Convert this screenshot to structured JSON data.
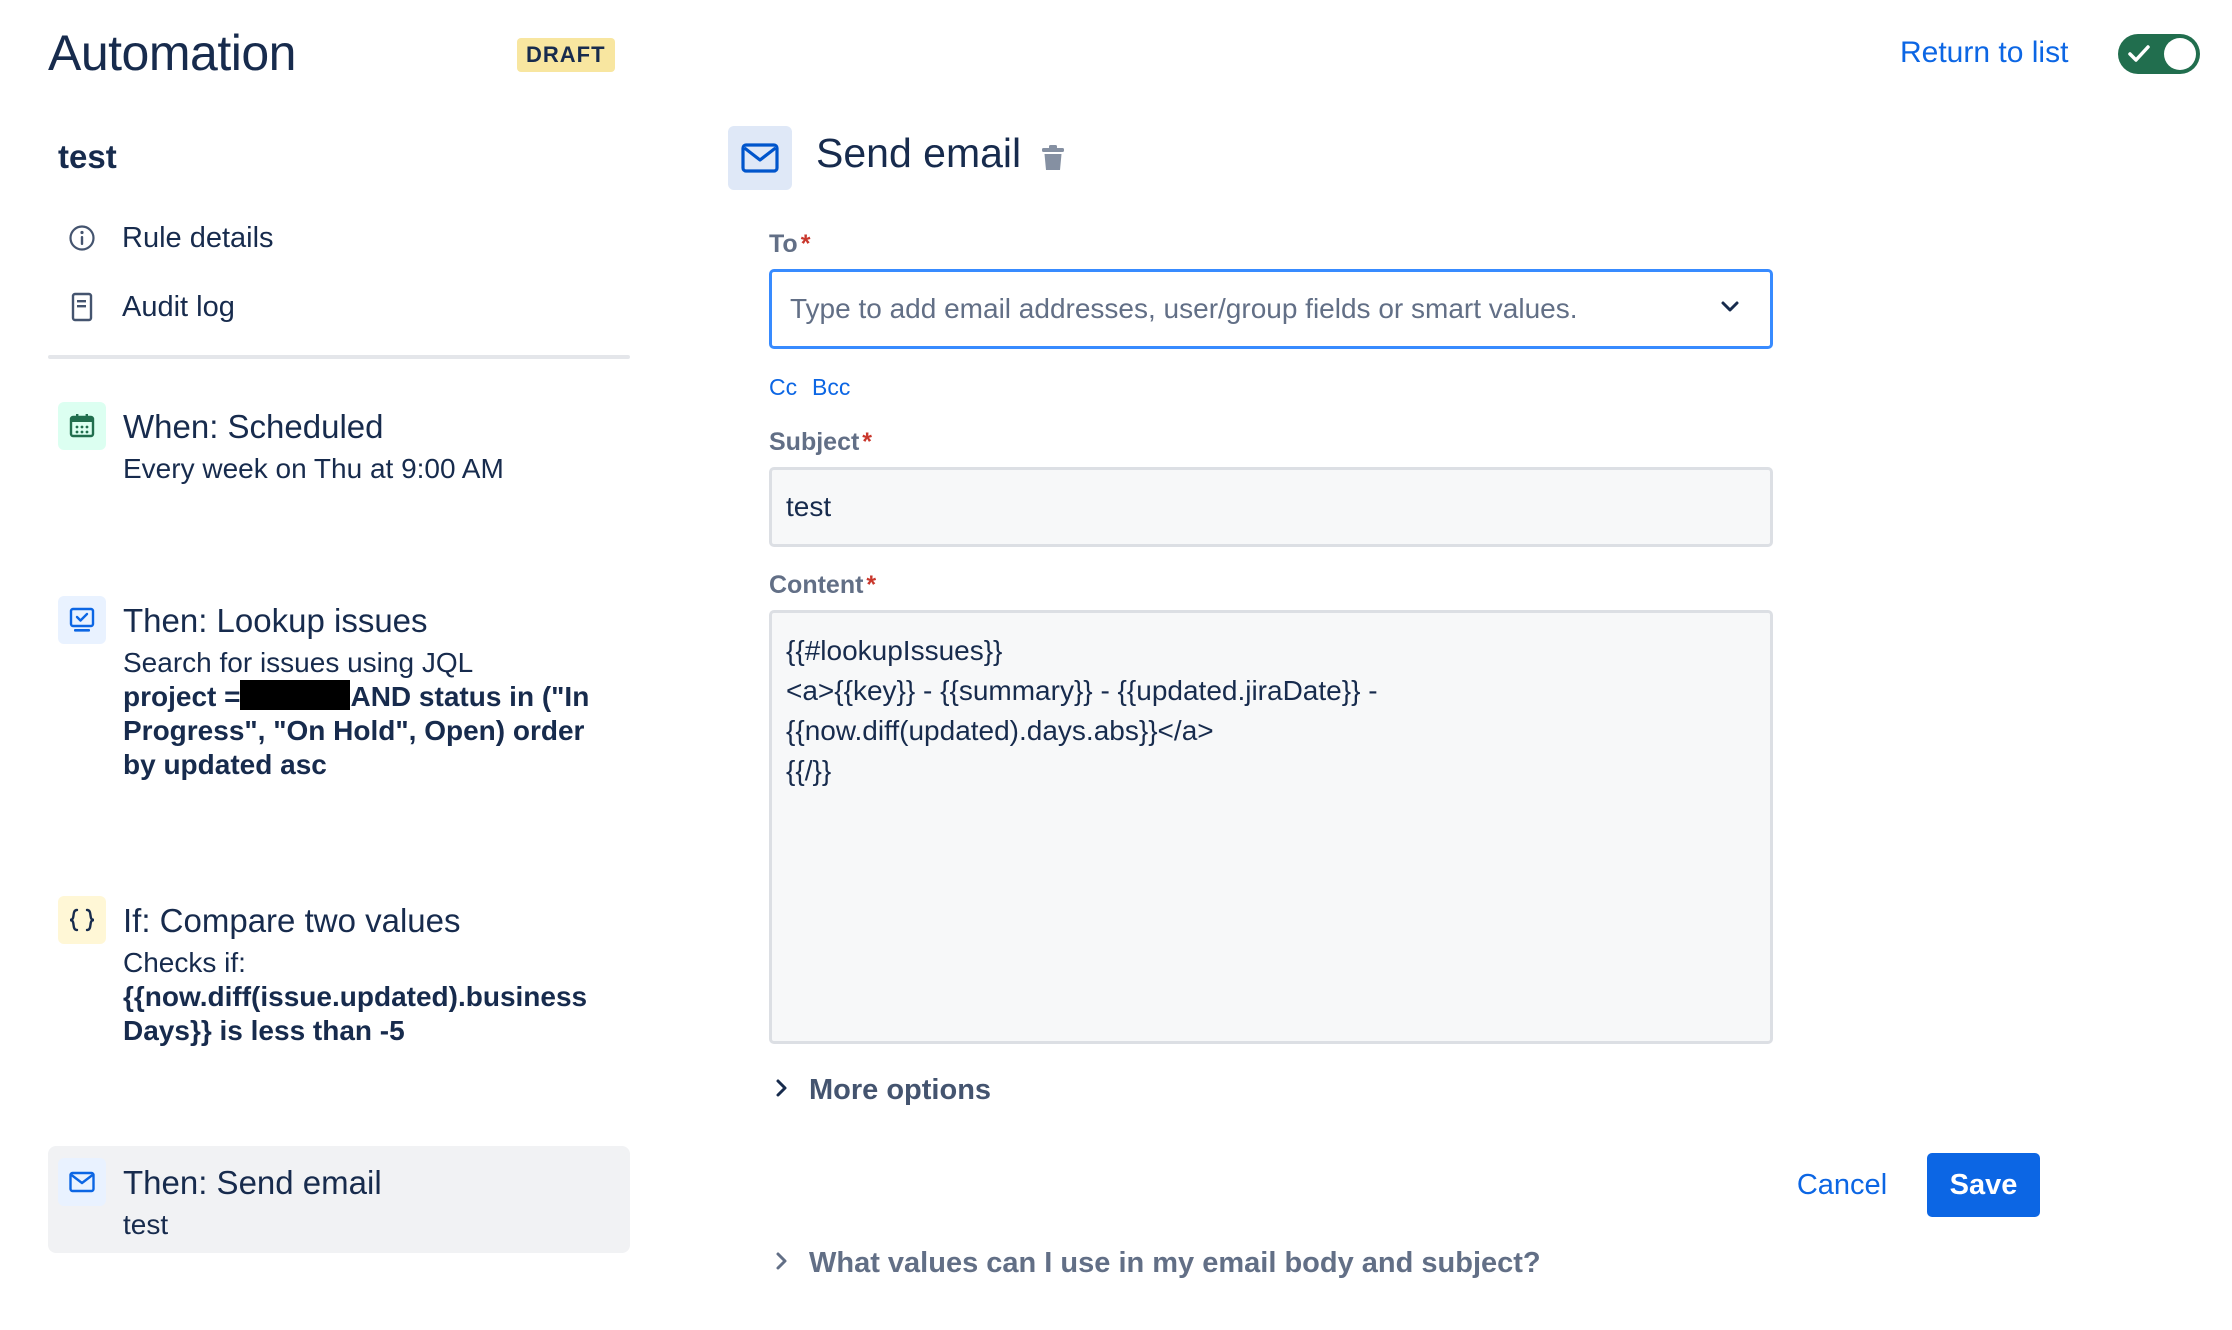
{
  "header": {
    "app_title": "Automation",
    "status_badge": "DRAFT",
    "return_link": "Return to list",
    "enabled_toggle": true
  },
  "sidebar": {
    "rule_name": "test",
    "nav": [
      {
        "label": "Rule details",
        "icon": "info-icon"
      },
      {
        "label": "Audit log",
        "icon": "document-icon"
      }
    ],
    "steps": [
      {
        "icon": "calendar-icon",
        "icon_bg": "#dcfff1",
        "title": "When: Scheduled",
        "desc": "Every week on Thu at 9:00 AM"
      },
      {
        "icon": "lookup-icon",
        "icon_bg": "#e9f2ff",
        "title": "Then: Lookup issues",
        "desc_line1": "Search for issues using JQL",
        "desc_bold_prefix": "project =",
        "desc_bold_suffix": "AND status in (\"In Progress\", \"On Hold\", Open) order by updated asc"
      },
      {
        "icon": "braces-icon",
        "icon_bg": "#fff7d6",
        "title": "If: Compare two values",
        "desc_line1": "Checks if:",
        "desc_bold": "{{now.diff(issue.updated).business Days}} is less than -5"
      },
      {
        "icon": "mail-icon",
        "icon_bg": "#e9f2ff",
        "title": "Then: Send email",
        "desc": "test",
        "active": true
      }
    ]
  },
  "panel": {
    "title": "Send email",
    "to": {
      "label": "To",
      "required_mark": "*",
      "placeholder": "Type to add email addresses, user/group fields or smart values."
    },
    "cc_label": "Cc",
    "bcc_label": "Bcc",
    "subject": {
      "label": "Subject",
      "required_mark": "*",
      "value": "test"
    },
    "content": {
      "label": "Content",
      "required_mark": "*",
      "value": "{{#lookupIssues}}\n<a>{{key}} - {{summary}} - {{updated.jiraDate}} -\n{{now.diff(updated).days.abs}}</a>\n{{/}}"
    },
    "more_options": "More options",
    "cancel_label": "Cancel",
    "save_label": "Save",
    "help_link": "What values can I use in my email body and subject?"
  },
  "colors": {
    "accent": "#0c66e4",
    "toggle_on": "#216e4e",
    "draft_badge_bg": "#f8e6a0",
    "required": "#c9372c"
  }
}
